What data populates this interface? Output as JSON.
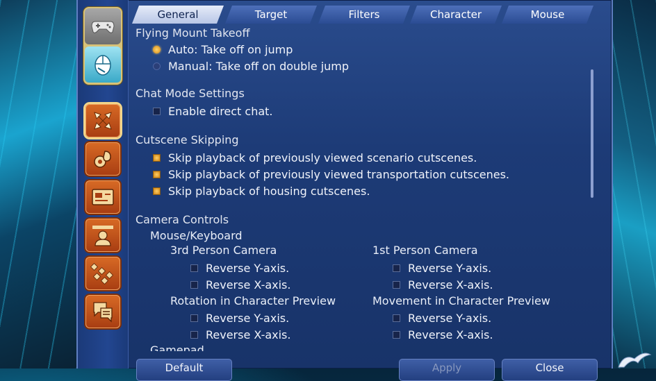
{
  "tabs": [
    {
      "label": "General",
      "active": true
    },
    {
      "label": "Target",
      "active": false
    },
    {
      "label": "Filters",
      "active": false
    },
    {
      "label": "Character",
      "active": false
    },
    {
      "label": "Mouse",
      "active": false
    }
  ],
  "sidebar": {
    "mode_buttons": [
      {
        "icon": "gamepad-icon",
        "active": false
      },
      {
        "icon": "mouse-icon",
        "active": true
      }
    ],
    "categories": [
      {
        "icon": "arrows-icon",
        "active": true
      },
      {
        "icon": "gear-bag-icon",
        "active": false
      },
      {
        "icon": "card-icon",
        "active": false
      },
      {
        "icon": "person-icon",
        "active": false
      },
      {
        "icon": "grid-icon",
        "active": false
      },
      {
        "icon": "chat-bubbles-icon",
        "active": false
      }
    ]
  },
  "flying_mount": {
    "title": "Flying Mount Takeoff",
    "options": [
      {
        "label": "Auto: Take off on jump",
        "selected": true
      },
      {
        "label": "Manual: Take off on double jump",
        "selected": false
      }
    ]
  },
  "chat_mode": {
    "title": "Chat Mode Settings",
    "options": [
      {
        "label": "Enable direct chat.",
        "checked": false
      }
    ]
  },
  "cutscene": {
    "title": "Cutscene Skipping",
    "options": [
      {
        "label": "Skip playback of previously viewed scenario cutscenes.",
        "checked": true
      },
      {
        "label": "Skip playback of previously viewed transportation cutscenes.",
        "checked": true
      },
      {
        "label": "Skip playback of housing cutscenes.",
        "checked": true
      }
    ]
  },
  "camera": {
    "title": "Camera Controls",
    "mouse_keyboard": "Mouse/Keyboard",
    "third_person": {
      "title": "3rd Person Camera",
      "y": "Reverse Y-axis.",
      "x": "Reverse X-axis."
    },
    "first_person": {
      "title": "1st Person Camera",
      "y": "Reverse Y-axis.",
      "x": "Reverse X-axis."
    },
    "rotation": {
      "title": "Rotation in Character Preview",
      "y": "Reverse Y-axis.",
      "x": "Reverse X-axis."
    },
    "movement": {
      "title": "Movement in Character Preview",
      "y": "Reverse Y-axis.",
      "x": "Reverse X-axis."
    },
    "gamepad_partial": "Gamepad"
  },
  "buttons": {
    "default": "Default",
    "apply": "Apply",
    "close": "Close"
  },
  "colors": {
    "window_bg": "#1d3b77",
    "accent_gold": "#e3a02e",
    "tab_active_bg": "#e6ecf9"
  }
}
